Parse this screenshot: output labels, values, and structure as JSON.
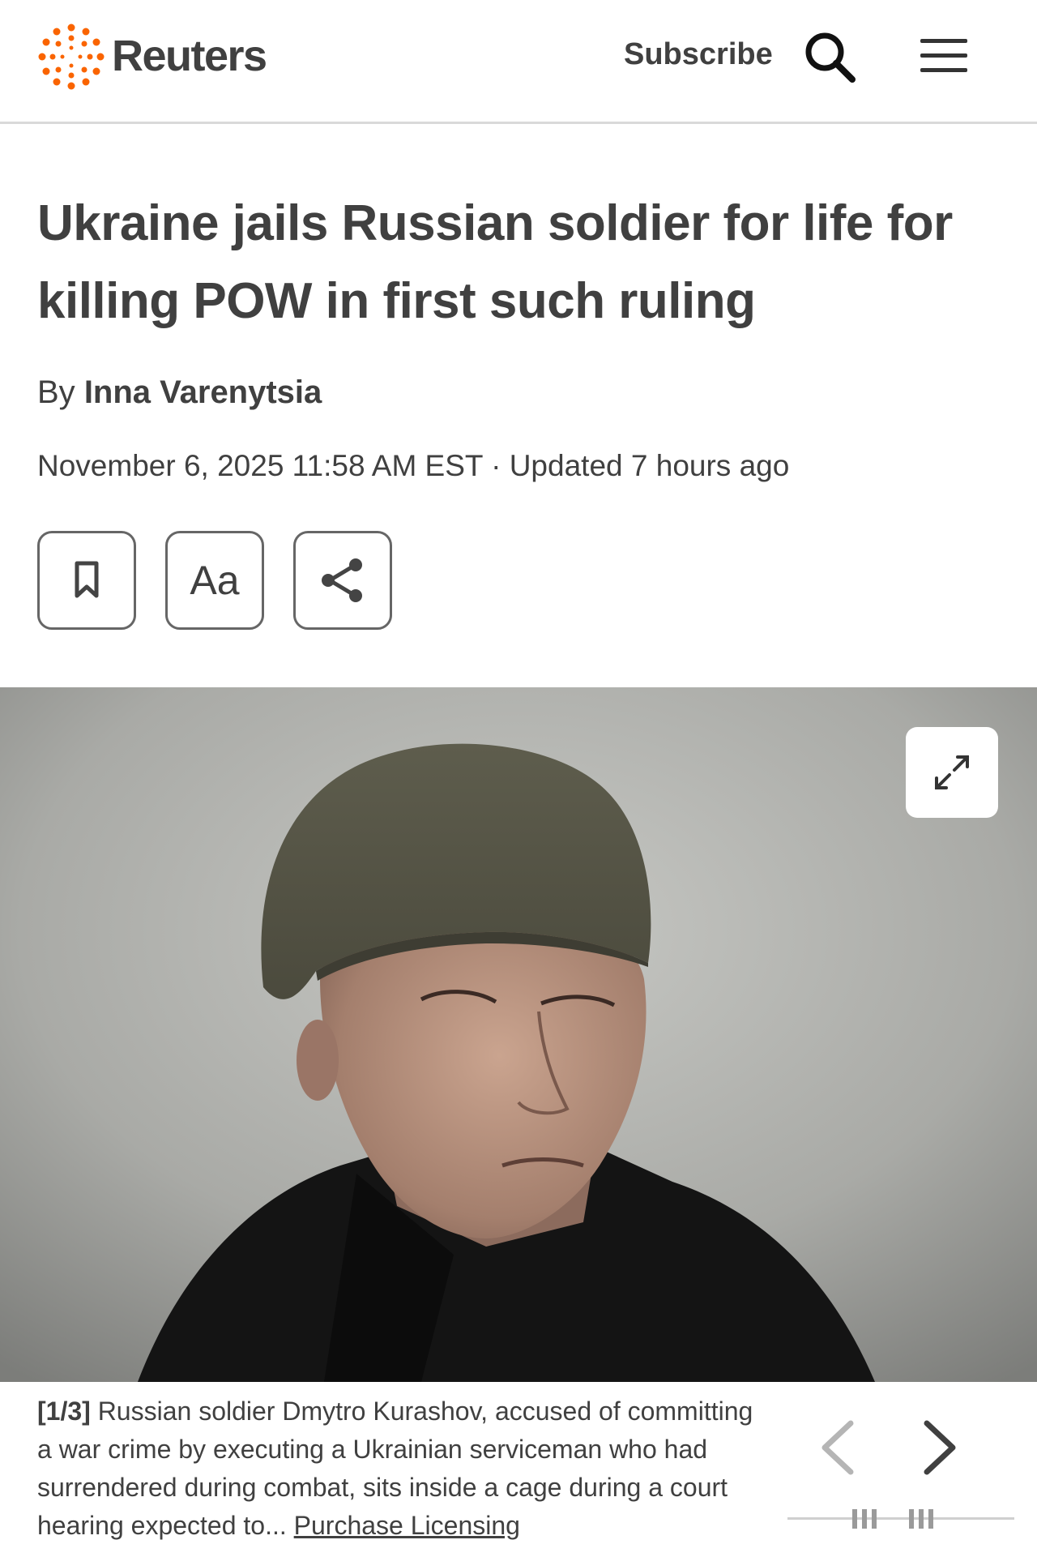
{
  "header": {
    "logo_text": "Reuters",
    "subscribe_label": "Subscribe",
    "icons": [
      "reuters-logo-icon",
      "search-icon",
      "menu-icon"
    ],
    "accent_color": "#fa6400"
  },
  "article": {
    "headline": "Ukraine jails Russian soldier for life for killing POW in first such ruling",
    "byline_prefix": "By",
    "author": "Inna Varenytsia",
    "dateline": "November 6, 2025 11:58 AM EST · Updated 7 hours ago",
    "actions": {
      "bookmark_icon": "bookmark-icon",
      "text_size_label": "Aa",
      "share_icon": "share-icon"
    }
  },
  "gallery": {
    "expand_icon": "expand-icon",
    "counter": "[1/3]",
    "caption": "Russian soldier Dmytro Kurashov, accused of committing a war crime by executing a Ukrainian serviceman who had surrendered during combat, sits inside a cage during a court hearing expected to...",
    "licensing_link": "Purchase Licensing",
    "prev_icon": "chevron-left-icon",
    "next_icon": "chevron-right-icon"
  }
}
